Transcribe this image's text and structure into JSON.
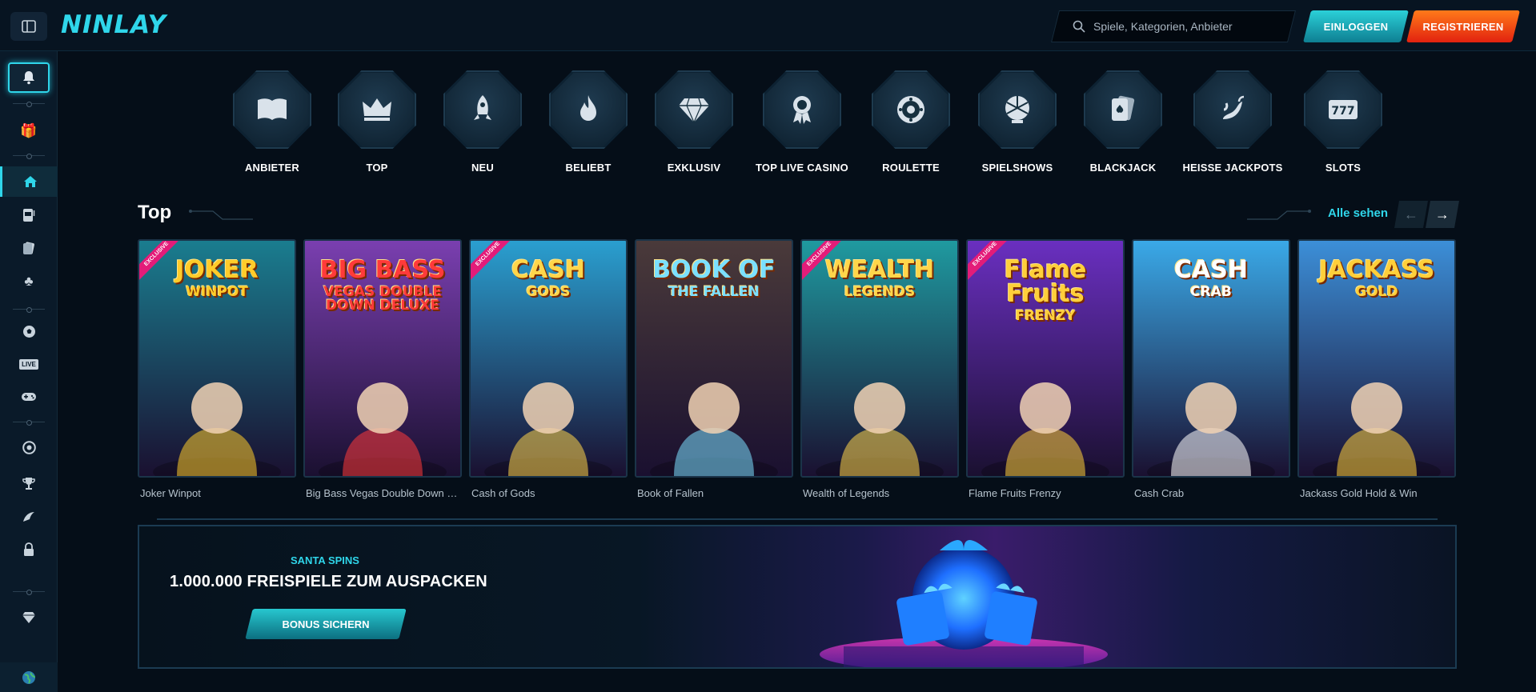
{
  "header": {
    "logo": "NINLAY",
    "search_placeholder": "Spiele, Kategorien, Anbieter",
    "login_label": "EINLOGGEN",
    "register_label": "REGISTRIEREN"
  },
  "sidebar": {
    "items": [
      {
        "icon": "bell-icon"
      },
      {
        "icon": "gift-icon"
      },
      {
        "icon": "home-icon",
        "active": true
      },
      {
        "icon": "slot-machine-icon"
      },
      {
        "icon": "cards-icon"
      },
      {
        "icon": "clover-icon"
      },
      {
        "icon": "soccer-ball-icon"
      },
      {
        "icon": "live-icon",
        "label": "LIVE"
      },
      {
        "icon": "gamepad-icon"
      },
      {
        "icon": "poker-chip-icon"
      },
      {
        "icon": "trophy-icon"
      },
      {
        "icon": "crash-icon"
      },
      {
        "icon": "lock-icon"
      },
      {
        "icon": "diamond-icon"
      },
      {
        "icon": "globe-icon"
      }
    ]
  },
  "categories": [
    {
      "label": "ANBIETER",
      "icon": "book-icon"
    },
    {
      "label": "TOP",
      "icon": "crown-icon"
    },
    {
      "label": "NEU",
      "icon": "rocket-icon"
    },
    {
      "label": "BELIEBT",
      "icon": "flame-icon"
    },
    {
      "label": "EXKLUSIV",
      "icon": "diamond-icon"
    },
    {
      "label": "TOP LIVE CASINO",
      "icon": "award-icon"
    },
    {
      "label": "ROULETTE",
      "icon": "roulette-icon"
    },
    {
      "label": "SPIELSHOWS",
      "icon": "wheel-icon"
    },
    {
      "label": "BLACKJACK",
      "icon": "cards-icon"
    },
    {
      "label": "HEISSE JACKPOTS",
      "icon": "chili-icon"
    },
    {
      "label": "SLOTS",
      "icon": "slot-777-icon"
    }
  ],
  "section": {
    "title": "Top",
    "see_all": "Alle sehen"
  },
  "games": [
    {
      "name": "Joker Winpot",
      "logo": "JOKER",
      "logo2": "WINPOT",
      "exclusive": true,
      "bg": "#1a7d8f"
    },
    {
      "name": "Big Bass Vegas Double Down Del...",
      "logo": "BIG BASS",
      "logo2": "VEGAS DOUBLE DOWN DELUXE",
      "exclusive": false,
      "bg": "#7a3fb0"
    },
    {
      "name": "Cash of Gods",
      "logo": "CASH",
      "logo2": "GODS",
      "exclusive": true,
      "bg": "#2a9fd0"
    },
    {
      "name": "Book of Fallen",
      "logo": "BOOK OF",
      "logo2": "THE FALLEN",
      "exclusive": false,
      "bg": "#4a3a3a"
    },
    {
      "name": "Wealth of Legends",
      "logo": "WEALTH",
      "logo2": "LEGENDS",
      "exclusive": true,
      "bg": "#1f9aa0"
    },
    {
      "name": "Flame Fruits Frenzy",
      "logo": "Flame Fruits",
      "logo2": "FRENZY",
      "exclusive": true,
      "bg": "#6a2fc0"
    },
    {
      "name": "Cash Crab",
      "logo": "CASH",
      "logo2": "CRAB",
      "exclusive": false,
      "bg": "#3aa9e8"
    },
    {
      "name": "Jackass Gold Hold & Win",
      "logo": "JACKASS",
      "logo2": "GOLD",
      "exclusive": false,
      "bg": "#3c8fd8"
    }
  ],
  "exclusive_label": "EXCLUSIVE",
  "banner": {
    "subtitle": "SANTA SPINS",
    "title": "1.000.000 FREISPIELE ZUM AUSPACKEN",
    "button": "BONUS SICHERN"
  },
  "colors": {
    "accent": "#2fd6ea",
    "register": "#e2220f"
  }
}
